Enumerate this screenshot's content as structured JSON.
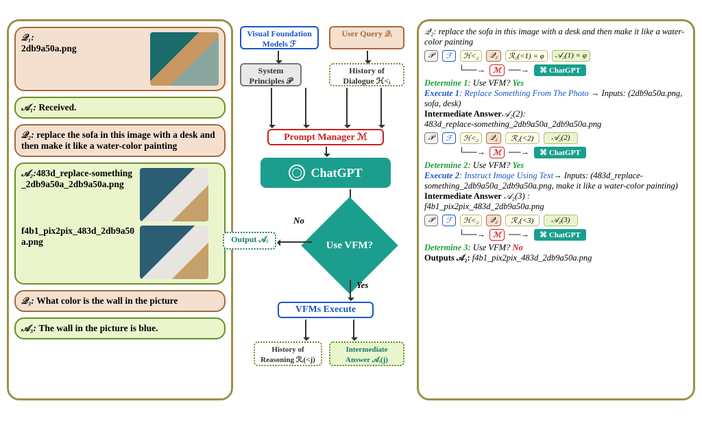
{
  "left": {
    "q1_label": "𝒬₁:",
    "q1_text": "2db9a50a.png",
    "a1_label": "𝒜₁:",
    "a1_text": "Received.",
    "q2_label": "𝒬₂:",
    "q2_text": "replace the sofa in this image with a desk and then make it like a water-color painting",
    "a2_label": "𝒜₂:",
    "a2_file1": "483d_replace-something_2db9a50a_2db9a50a.png",
    "a2_file2": "f4b1_pix2pix_483d_2db9a50a.png",
    "q3_label": "𝒬₃:",
    "q3_text": "What color is the wall in the picture",
    "a3_label": "𝒜₃:",
    "a3_text": "The wall in the picture is blue."
  },
  "flow": {
    "vfm_models": "Visual Foundation Models ℱ",
    "user_query": "User Query 𝒬ᵢ",
    "sys_principles": "System Principles 𝒫",
    "history_dialogue": "History of Dialogue ℋ<ᵢ",
    "prompt_manager": "Prompt  Manager ℳ",
    "chatgpt": "ChatGPT",
    "use_vfm": "Use VFM?",
    "no": "No",
    "yes": "Yes",
    "output": "Output 𝒜ᵢ",
    "vfms_execute": "VFMs Execute",
    "history_reasoning": "History of Reasoning ℛᵢ(<j)",
    "intermediate_answer": "Intermediate Answer 𝒜ᵢ(j)"
  },
  "right": {
    "q2_full": "𝒬₂: replace the sofa in this image with a desk and then make it like a water-color painting",
    "sym_P": "𝒫",
    "sym_F": "ℱ",
    "sym_H": "ℋ<₂",
    "sym_Q": "𝒬₂",
    "sym_R1": "ℛ₂(<1) = φ",
    "sym_A1": "𝒜₂(1) = φ",
    "sym_M": "ℳ",
    "sym_R2": "ℛ₂(<2)",
    "sym_A2": "𝒜₂(2)",
    "sym_R3": "ℛ₂(<3)",
    "sym_A3": "𝒜₂(3)",
    "det1_lbl": "Determine 1",
    "det1_q": ": Use VFM?",
    "det1_ans": "Yes",
    "exec1_lbl": "Execute 1",
    "exec1_action": ": Replace Something From The Photo",
    "exec1_arrow": " → Inputs: (2db9a50a.png, sofa, desk)",
    "int1_lbl": "Intermediate Answer",
    "int1_sym": "𝒜₂(2):",
    "int1_val": "483d_replace-something_2db9a50a_2db9a50a.png",
    "det2_lbl": "Determine 2",
    "det2_q": ": Use VFM?",
    "det2_ans": "Yes",
    "exec2_lbl": "Execute 2",
    "exec2_action": ": Instruct Image Using Text",
    "exec2_arrow": "→ Inputs: (483d_replace-something_2db9a50a_2db9a50a.png, make it like a water-color painting)",
    "int2_lbl": "Intermediate Answer",
    "int2_sym": " 𝒜₂(3) :",
    "int2_val": "f4b1_pix2pix_483d_2db9a50a.png",
    "det3_lbl": "Determine 3",
    "det3_q": ": Use VFM?",
    "det3_ans": "No",
    "outputs_lbl": "Outputs 𝒜₂:",
    "outputs_val": " f4b1_pix2pix_483d_2db9a50a.png",
    "chatgpt": "ChatGPT"
  }
}
